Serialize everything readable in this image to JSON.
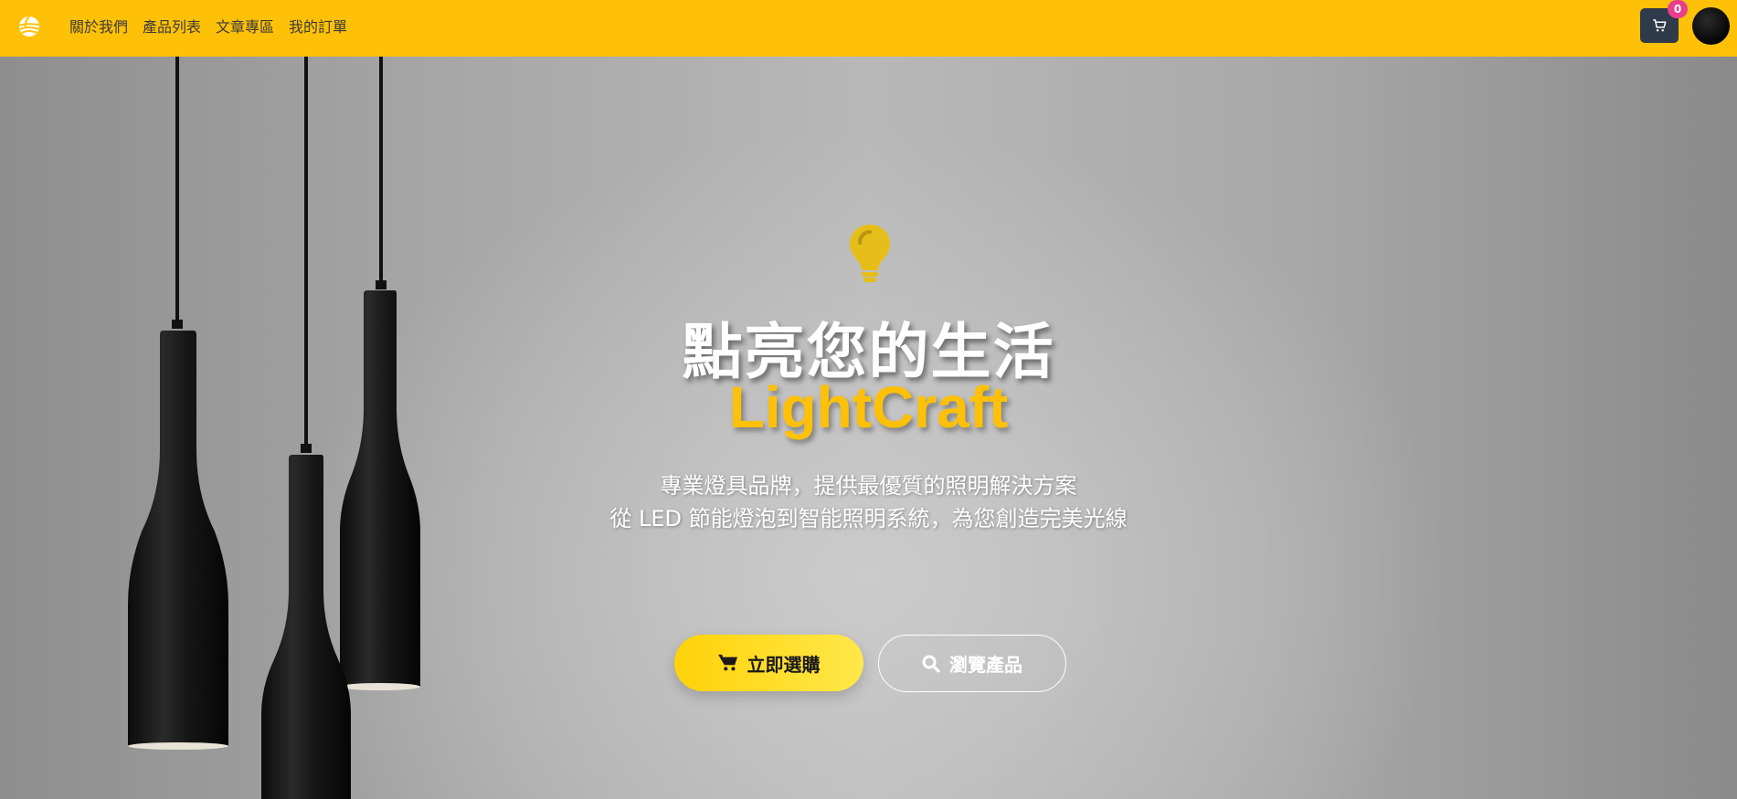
{
  "nav": {
    "links": [
      "關於我們",
      "產品列表",
      "文章專區",
      "我的訂單"
    ],
    "cart_count": "0"
  },
  "hero": {
    "title": "點亮您的生活",
    "brand": "LightCraft",
    "subtitle_line1": "專業燈具品牌，提供最優質的照明解決方案",
    "subtitle_line2": "從 LED 節能燈泡到智能照明系統，為您創造完美光線",
    "primary_button": "立即選購",
    "secondary_button": "瀏覽產品"
  },
  "colors": {
    "navbar": "#ffc107",
    "accent": "#ffc107",
    "badge": "#e83e8c",
    "cart_button": "#2f3a4a"
  },
  "icons": {
    "logo": "sun-logo-icon",
    "cart": "cart-icon",
    "bulb": "lightbulb-icon",
    "search": "search-icon"
  }
}
